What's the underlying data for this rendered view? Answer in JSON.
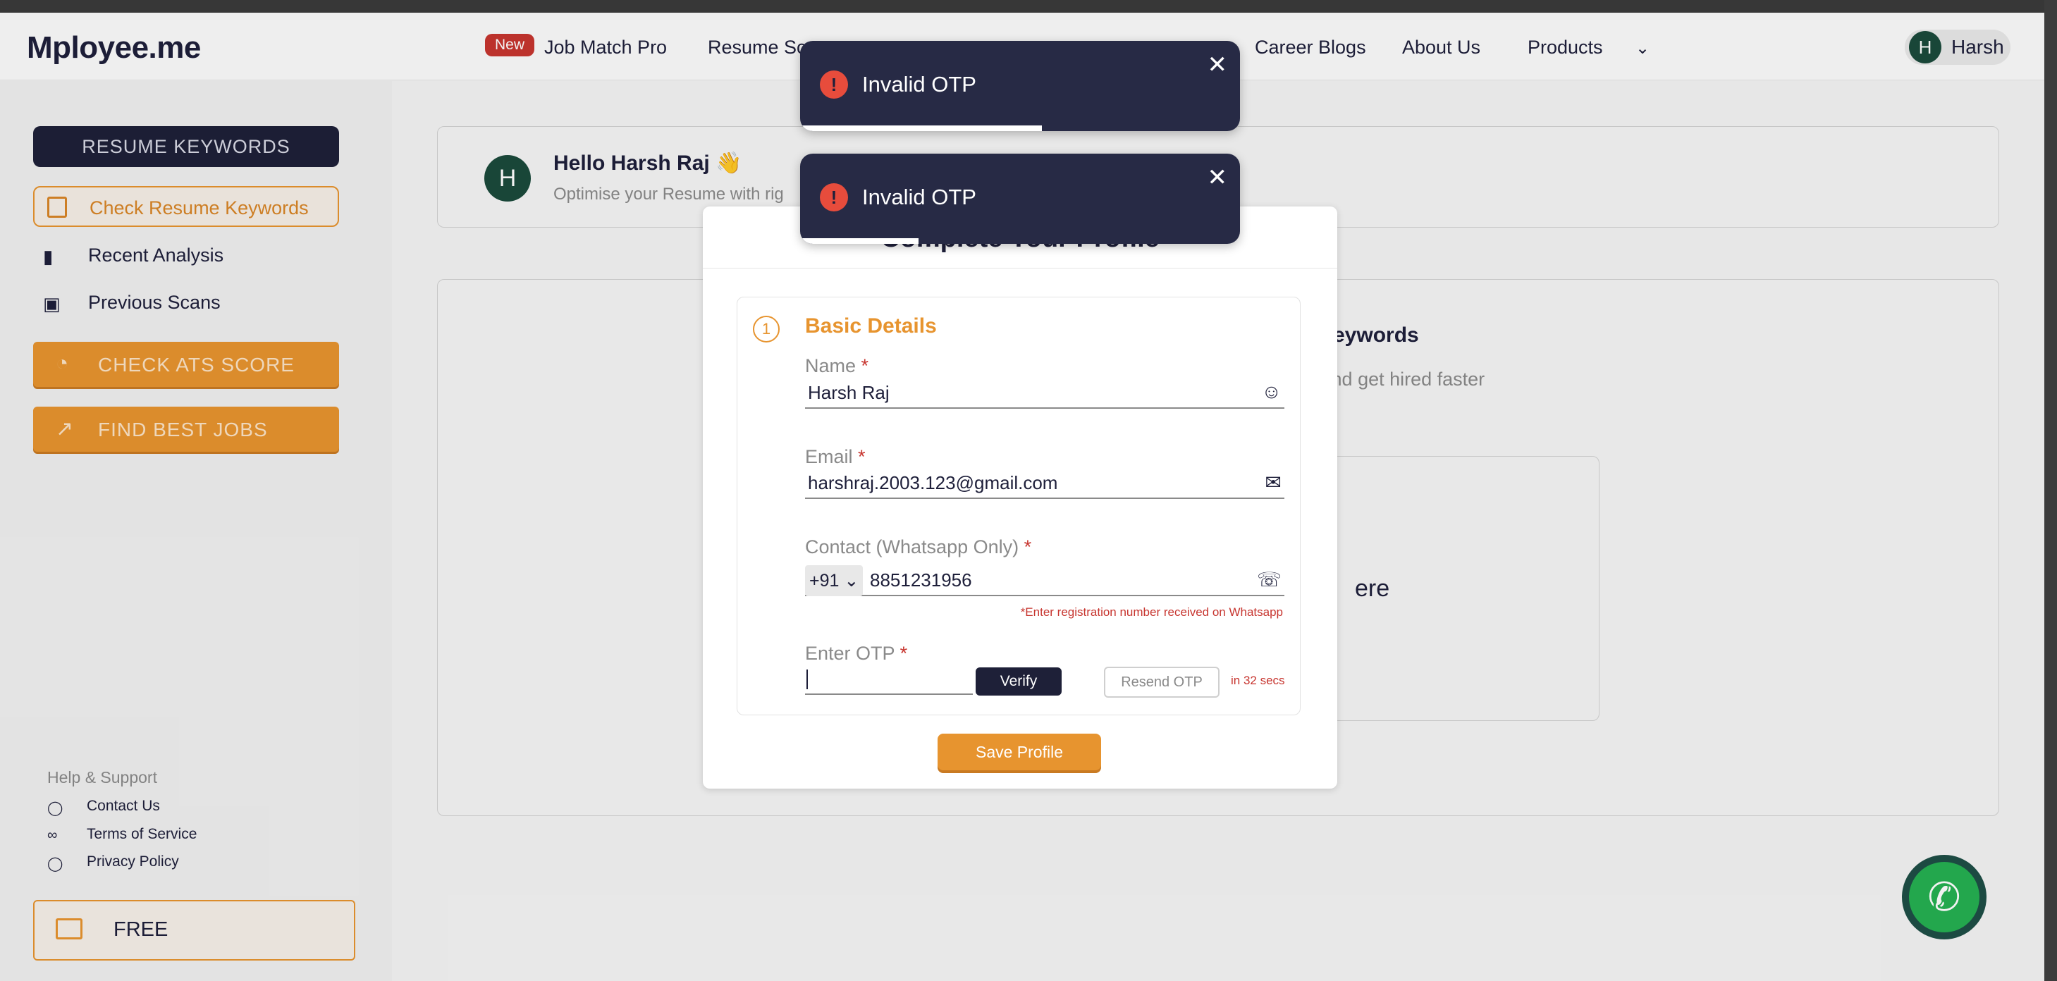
{
  "header": {
    "logo": "Mployee.me",
    "new_badge": "New",
    "nav": [
      "Job Match Pro",
      "Resume Sc",
      "Career Blogs",
      "About Us",
      "Products"
    ],
    "user_initial": "H",
    "user_name": "Harsh"
  },
  "sidebar": {
    "resume_keywords": "RESUME KEYWORDS",
    "check_resume_keywords": "Check Resume Keywords",
    "recent_analysis": "Recent Analysis",
    "previous_scans": "Previous Scans",
    "check_ats_score": "CHECK ATS SCORE",
    "find_best_jobs": "FIND BEST JOBS",
    "help_title": "Help & Support",
    "contact_us": "Contact Us",
    "terms": "Terms of Service",
    "privacy": "Privacy Policy",
    "plan": "FREE"
  },
  "main": {
    "avatar_initial": "H",
    "hello": "Hello Harsh Raj 👋",
    "hello_sub": "Optimise your Resume with rig",
    "card_title": "t Keywords",
    "card_sub": "e and get hired faster",
    "inner_text": "ere"
  },
  "modal": {
    "title": "Complete Your Profile",
    "step_number": "1",
    "step_title": "Basic Details",
    "name_label": "Name",
    "name_value": "Harsh Raj",
    "email_label": "Email",
    "email_value": "harshraj.2003.123@gmail.com",
    "contact_label": "Contact (Whatsapp Only)",
    "country_code": "+91",
    "phone_value": "8851231956",
    "hint": "*Enter registration number received on Whatsapp",
    "otp_label": "Enter OTP",
    "verify": "Verify",
    "resend": "Resend OTP",
    "timer": "in 32 secs",
    "save": "Save Profile",
    "required_mark": "*"
  },
  "toasts": [
    {
      "message": "Invalid OTP",
      "progress": 0.55
    },
    {
      "message": "Invalid OTP",
      "progress": 0.27
    }
  ],
  "colors": {
    "accent": "#e7942f",
    "navy": "#1e2038",
    "error": "#c7352f",
    "whatsapp": "#25b052"
  }
}
